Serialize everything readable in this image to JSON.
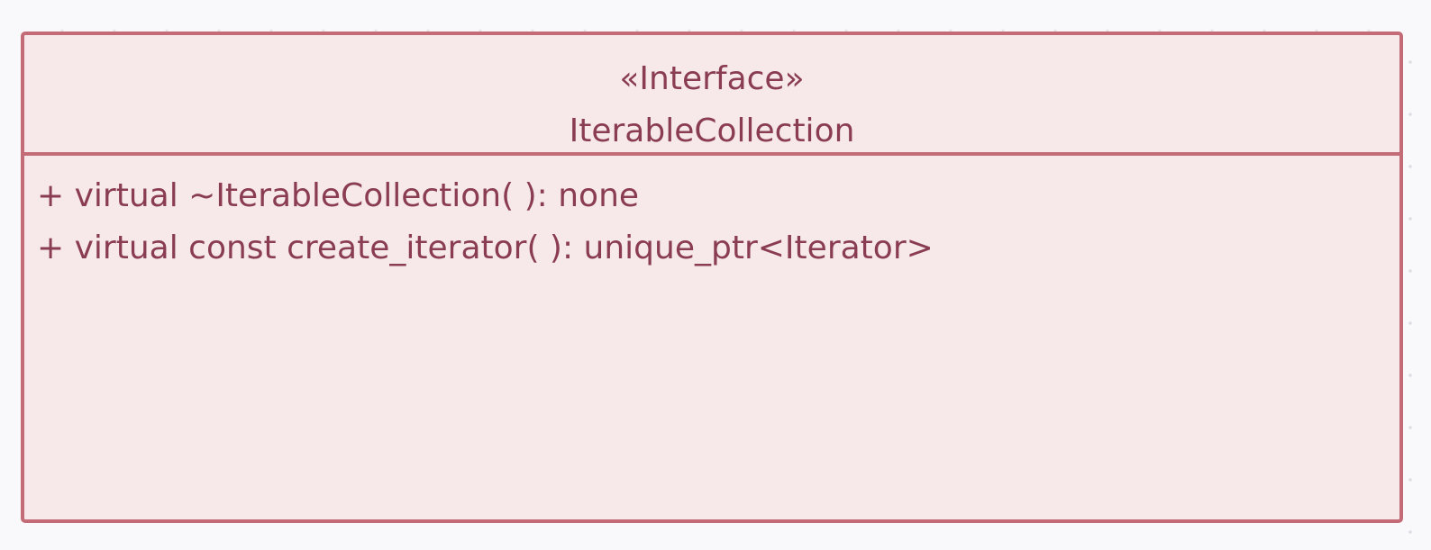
{
  "diagram": {
    "type": "uml-class",
    "class": {
      "stereotype": "«Interface»",
      "name": "IterableCollection",
      "methods": [
        "+ virtual ~IterableCollection( ): none",
        "+ virtual const create_iterator( ): unique_ptr<Iterator>"
      ]
    },
    "colors": {
      "background": "#f9f9fb",
      "box_fill": "#f7e8ea",
      "box_border": "#c46b78",
      "text": "#8a3d52"
    }
  }
}
